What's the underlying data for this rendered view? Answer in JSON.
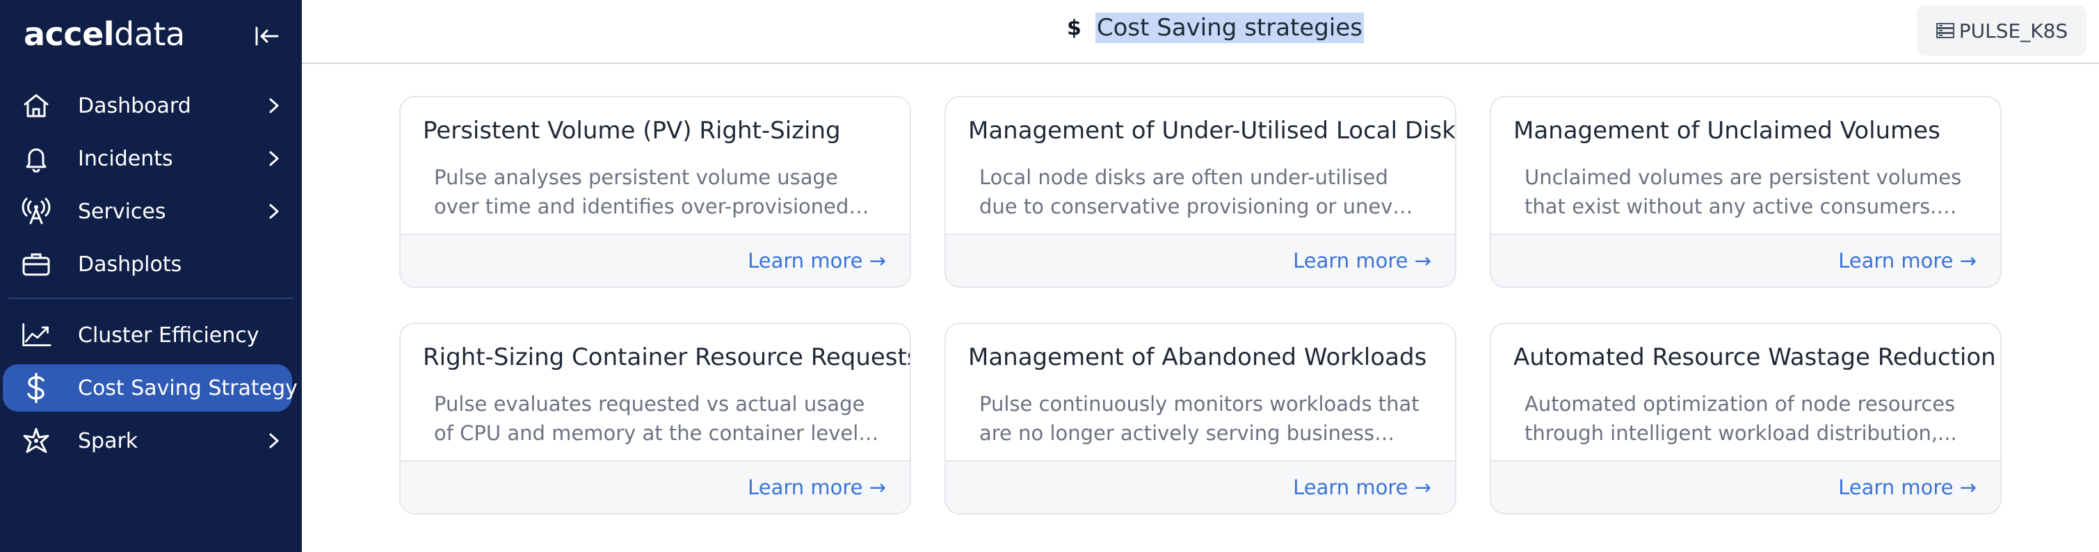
{
  "brand": {
    "logo_bold": "accel",
    "logo_light": "data"
  },
  "sidebar": {
    "items": [
      {
        "label": "Dashboard",
        "icon": "home-icon",
        "has_submenu": true
      },
      {
        "label": "Incidents",
        "icon": "bell-icon",
        "has_submenu": true
      },
      {
        "label": "Services",
        "icon": "antenna-icon",
        "has_submenu": true
      },
      {
        "label": "Dashplots",
        "icon": "briefcase-icon",
        "has_submenu": false
      },
      {
        "label": "Cluster Efficiency",
        "icon": "trend-chart-icon",
        "has_submenu": false
      },
      {
        "label": "Cost Saving Strategy",
        "icon": "dollar-icon",
        "has_submenu": false,
        "active": true
      },
      {
        "label": "Spark",
        "icon": "spark-icon",
        "has_submenu": true
      }
    ]
  },
  "header": {
    "icon": "$",
    "title": "Cost Saving strategies",
    "cluster": "PULSE_K8S"
  },
  "cards": [
    {
      "title": "Persistent Volume (PV) Right-Sizing",
      "description": "Pulse analyses persistent volume usage over time and identifies over-provisioned volumes,...",
      "link": "Learn more →"
    },
    {
      "title": "Management of Under-Utilised Local Disks",
      "description": "Local node disks are often under-utilised due to conservative provisioning or uneven workload...",
      "link": "Learn more →"
    },
    {
      "title": "Management of Unclaimed Volumes",
      "description": "Unclaimed volumes are persistent volumes that exist without any active consumers. Pulse...",
      "link": "Learn more →"
    },
    {
      "title": "Right-Sizing Container Resource Requests",
      "description": "Pulse evaluates requested vs actual usage of CPU and memory at the container level and...",
      "link": "Learn more →"
    },
    {
      "title": "Management of Abandoned Workloads",
      "description": "Pulse continuously monitors workloads that are no longer actively serving business needs, such...",
      "link": "Learn more →"
    },
    {
      "title": "Automated Resource Wastage Reduction",
      "description": "Automated optimization of node resources through intelligent workload distribution,...",
      "link": "Learn more →"
    }
  ],
  "colors": {
    "sidebar_bg": "#0f1f47",
    "active_bg": "#2f5bb7",
    "link": "#3b74d6",
    "title_highlight": "#c7d9f6"
  }
}
